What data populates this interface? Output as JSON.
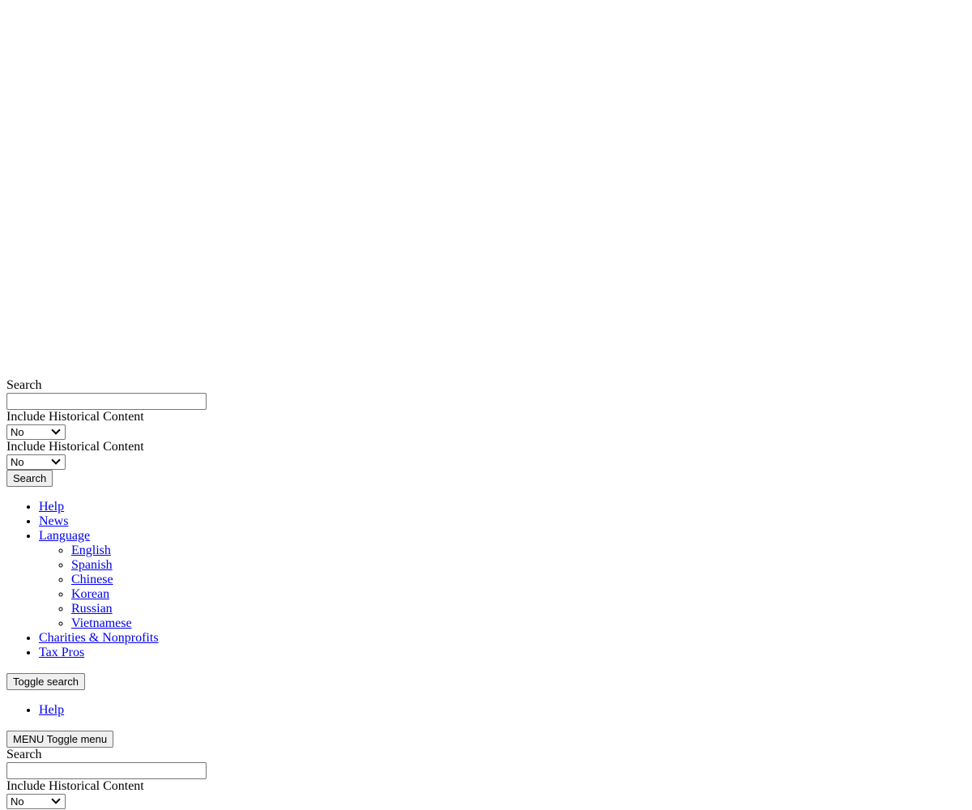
{
  "search_block_1": {
    "search_label": "Search",
    "search_value": "",
    "historical_label_1": "Include Historical Content",
    "historical_value_1": "No",
    "historical_label_2": "Include Historical Content",
    "historical_value_2": "No",
    "search_button": "Search"
  },
  "nav": {
    "items": [
      {
        "label": "Help"
      },
      {
        "label": "News"
      },
      {
        "label": "Language",
        "children": [
          {
            "label": "English"
          },
          {
            "label": "Spanish"
          },
          {
            "label": "Chinese"
          },
          {
            "label": "Korean"
          },
          {
            "label": "Russian"
          },
          {
            "label": "Vietnamese"
          }
        ]
      },
      {
        "label": "Charities & Nonprofits"
      },
      {
        "label": "Tax Pros"
      }
    ]
  },
  "toggle_search_button": "Toggle search",
  "secondary_nav": {
    "items": [
      {
        "label": "Help"
      }
    ]
  },
  "toggle_menu_button": "MENU Toggle menu",
  "search_block_2": {
    "search_label": "Search",
    "search_value": "",
    "historical_label": "Include Historical Content",
    "historical_value": "No"
  }
}
